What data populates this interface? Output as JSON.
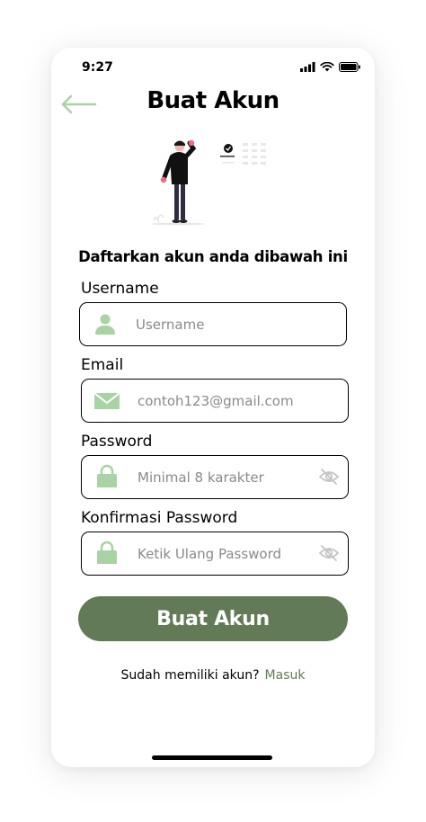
{
  "status": {
    "time": "9:27"
  },
  "header": {
    "title": "Buat Akun"
  },
  "subtitle": "Daftarkan akun anda dibawah ini",
  "fields": {
    "username": {
      "label": "Username",
      "placeholder": "Username"
    },
    "email": {
      "label": "Email",
      "placeholder": "contoh123@gmail.com"
    },
    "password": {
      "label": "Password",
      "placeholder": "Minimal 8 karakter"
    },
    "confirm": {
      "label": "Konfirmasi Password",
      "placeholder": "Ketik Ulang Password"
    }
  },
  "submit_label": "Buat Akun",
  "footer": {
    "text": "Sudah memiliki akun?",
    "link": "Masuk"
  },
  "colors": {
    "accent": "#627a55",
    "icon": "#a9d3a4"
  },
  "icons": [
    "back-arrow-icon",
    "user-icon",
    "mail-icon",
    "lock-icon",
    "eye-off-icon",
    "signal-icon",
    "wifi-icon",
    "battery-icon"
  ]
}
